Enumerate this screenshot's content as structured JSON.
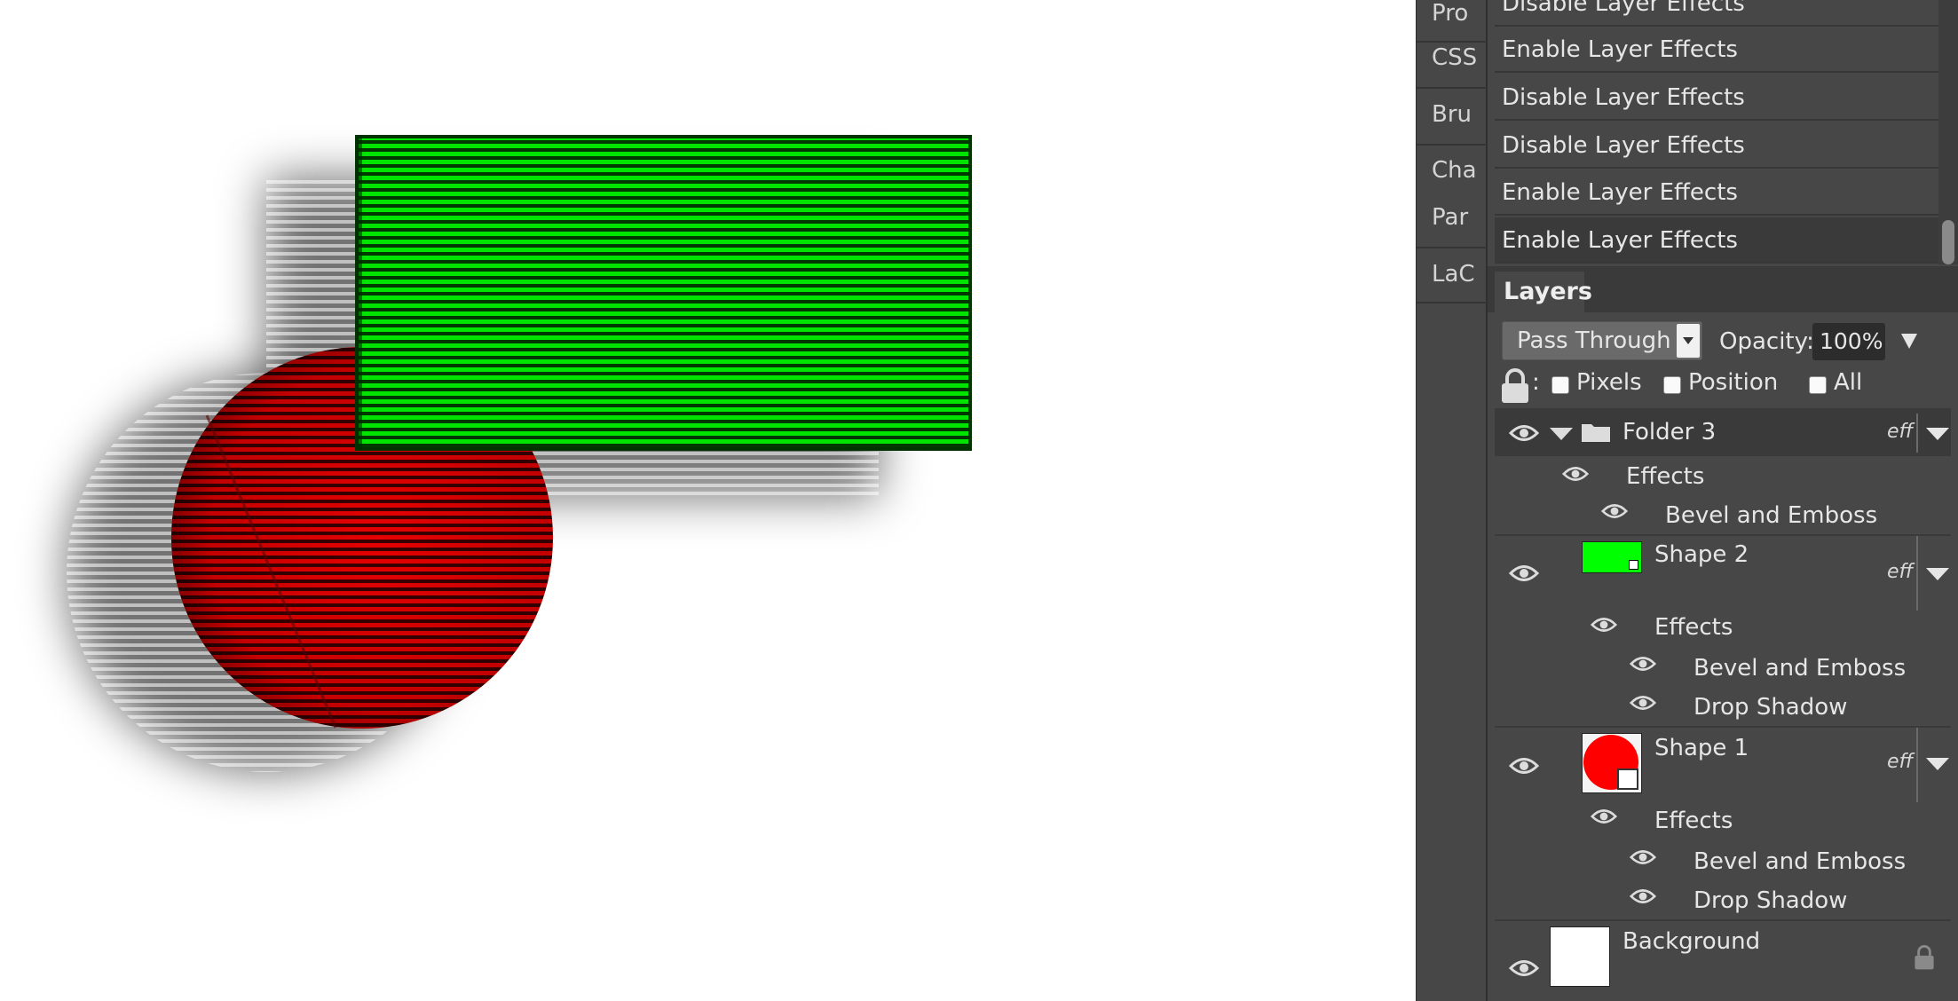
{
  "sidebar": {
    "tabs": [
      "Pro",
      "CSS",
      "Bru",
      "Cha",
      "Par",
      "LaC"
    ]
  },
  "history": {
    "items": [
      {
        "label": "Disable Layer Effects"
      },
      {
        "label": "Enable Layer Effects"
      },
      {
        "label": "Disable Layer Effects"
      },
      {
        "label": "Disable Layer Effects"
      },
      {
        "label": "Enable Layer Effects"
      },
      {
        "label": "Enable Layer Effects",
        "current": true
      }
    ]
  },
  "layers_panel": {
    "tab_label": "Layers",
    "blend_mode": "Pass Through",
    "opacity_label": "Opacity:",
    "opacity_value": "100%",
    "lock_colon": ":",
    "lock_options": [
      "Pixels",
      "Position",
      "All"
    ],
    "eff_label": "eff",
    "layers": [
      {
        "name": "Folder 3",
        "type": "folder",
        "effects_label": "Effects",
        "effects": [
          "Bevel and Emboss"
        ]
      },
      {
        "name": "Shape 2",
        "type": "shape",
        "thumb_color": "#00ff00",
        "effects_label": "Effects",
        "effects": [
          "Bevel and Emboss",
          "Drop Shadow"
        ]
      },
      {
        "name": "Shape 1",
        "type": "shape",
        "thumb_color": "#ff0000",
        "effects_label": "Effects",
        "effects": [
          "Bevel and Emboss",
          "Drop Shadow"
        ]
      },
      {
        "name": "Background",
        "type": "background",
        "locked": true
      }
    ]
  },
  "canvas": {
    "rect_color": "#00ff00",
    "circle_color": "#ff0000",
    "background": "#ffffff"
  },
  "colors": {
    "panel_bg": "#474747",
    "panel_dark": "#3a3a3a",
    "text": "#e6e6e6"
  },
  "icons": [
    "eye-icon",
    "folder-icon",
    "lock-icon",
    "disclosure-triangle-icon",
    "dropdown-arrow-icon"
  ]
}
